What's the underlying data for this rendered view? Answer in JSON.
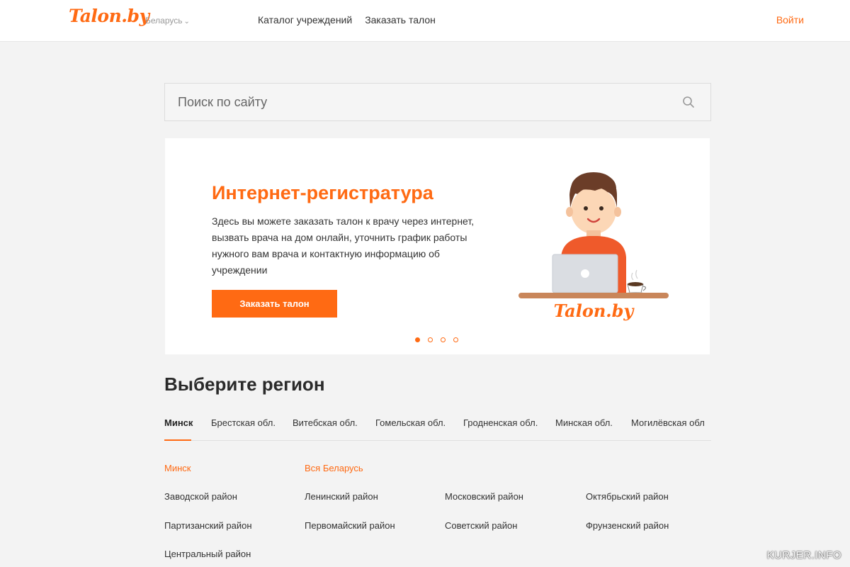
{
  "header": {
    "logo": "Talon.by",
    "country": "Беларусь",
    "nav": [
      "Каталог учреждений",
      "Заказать талон"
    ],
    "login": "Войти"
  },
  "search": {
    "placeholder": "Поиск по сайту"
  },
  "banner": {
    "title": "Интернет-регистратура",
    "text": "Здесь вы можете заказать талон к врачу через интернет, вызвать врача на дом онлайн, уточнить график работы нужного вам врача и контактную информацию об учреждении",
    "button": "Заказать талон",
    "art_logo": "Talon.by",
    "slides_total": 4,
    "active_slide": 1
  },
  "region": {
    "title": "Выберите регион",
    "tabs": [
      "Минск",
      "Брестская обл.",
      "Витебская обл.",
      "Гомельская обл.",
      "Гродненская обл.",
      "Минская обл.",
      "Могилёвская обл"
    ],
    "active_tab": "Минск",
    "column_heads": [
      "Минск",
      "Вся Беларусь"
    ],
    "districts": [
      "Заводской район",
      "Ленинский район",
      "Московский район",
      "Октябрьский район",
      "Партизанский район",
      "Первомайский район",
      "Советский район",
      "Фрунзенский район",
      "Центральный район"
    ]
  },
  "colors": {
    "accent": "#ff6a13"
  },
  "watermark": "KURJER.INFO"
}
